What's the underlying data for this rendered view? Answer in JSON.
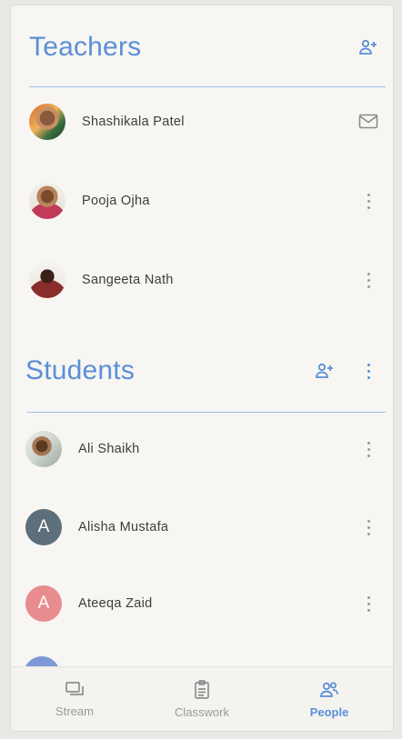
{
  "teachers": {
    "title": "Teachers",
    "people": [
      {
        "name": "Shashikala Patel",
        "action": "mail-icon"
      },
      {
        "name": "Pooja Ojha",
        "action": "more-vert-icon"
      },
      {
        "name": "Sangeeta Nath",
        "action": "more-vert-icon"
      }
    ]
  },
  "students": {
    "title": "Students",
    "people": [
      {
        "name": "Ali Shaikh",
        "avatar_type": "photo"
      },
      {
        "name": "Alisha Mustafa",
        "avatar_letter": "A",
        "avatar_color": "#5c6f7a"
      },
      {
        "name": "Ateeqa Zaid",
        "avatar_letter": "A",
        "avatar_color": "#e98c8f"
      }
    ]
  },
  "nav": {
    "stream": "Stream",
    "classwork": "Classwork",
    "people": "People"
  },
  "colors": {
    "accent": "#5b8fd6",
    "text": "#3d3d3d",
    "muted": "#9a9a9a"
  }
}
